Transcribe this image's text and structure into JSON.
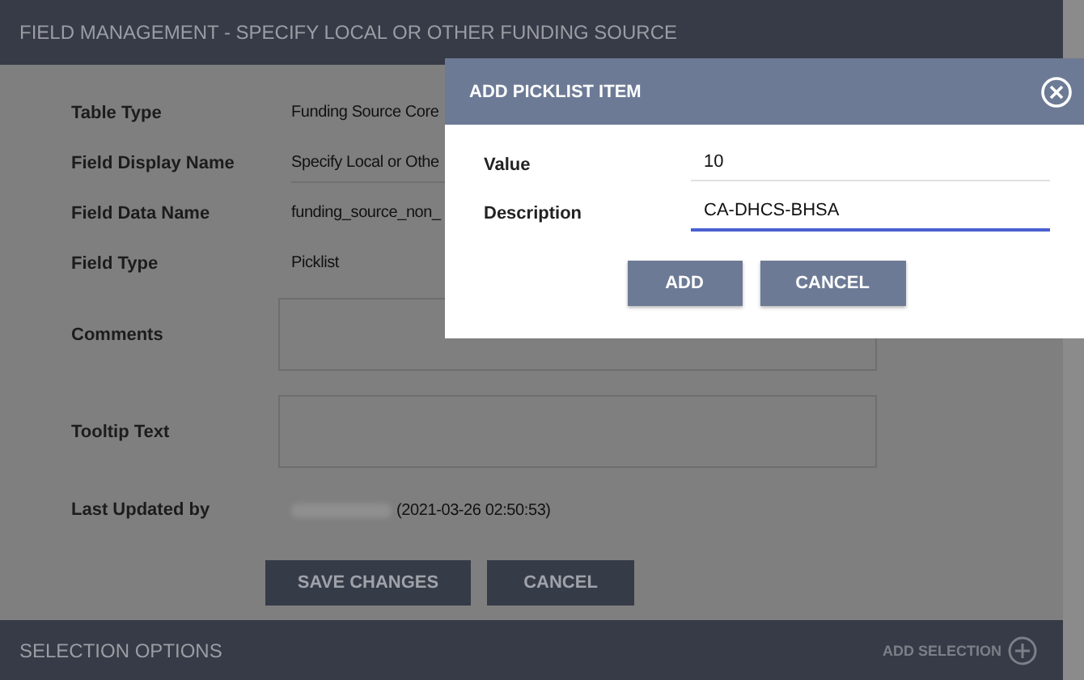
{
  "page": {
    "title": "FIELD MANAGEMENT - SPECIFY LOCAL OR OTHER FUNDING SOURCE"
  },
  "fields": [
    {
      "label": "Table Type",
      "value": "Funding Source Core",
      "kind": "text"
    },
    {
      "label": "Field Display Name",
      "value": "Specify Local or Othe",
      "kind": "input"
    },
    {
      "label": "Field Data Name",
      "value": "funding_source_non_",
      "kind": "text"
    },
    {
      "label": "Field Type",
      "value": "Picklist",
      "kind": "text"
    },
    {
      "label": "Comments",
      "kind": "textarea"
    },
    {
      "label": "Tooltip Text",
      "kind": "textarea"
    },
    {
      "label": "Last Updated by",
      "value": "(2021-03-26 02:50:53)",
      "kind": "redacted"
    }
  ],
  "buttons": [
    "SAVE CHANGES",
    "CANCEL"
  ],
  "section": {
    "title": "SELECTION OPTIONS",
    "action": "ADD SELECTION"
  },
  "dialog": {
    "title": "ADD PICKLIST ITEM",
    "fields": [
      {
        "label": "Value",
        "value": "10",
        "focused": false
      },
      {
        "label": "Description",
        "value": "CA-DHCS-BHSA",
        "focused": true
      }
    ],
    "buttons": [
      "ADD",
      "CANCEL"
    ]
  }
}
